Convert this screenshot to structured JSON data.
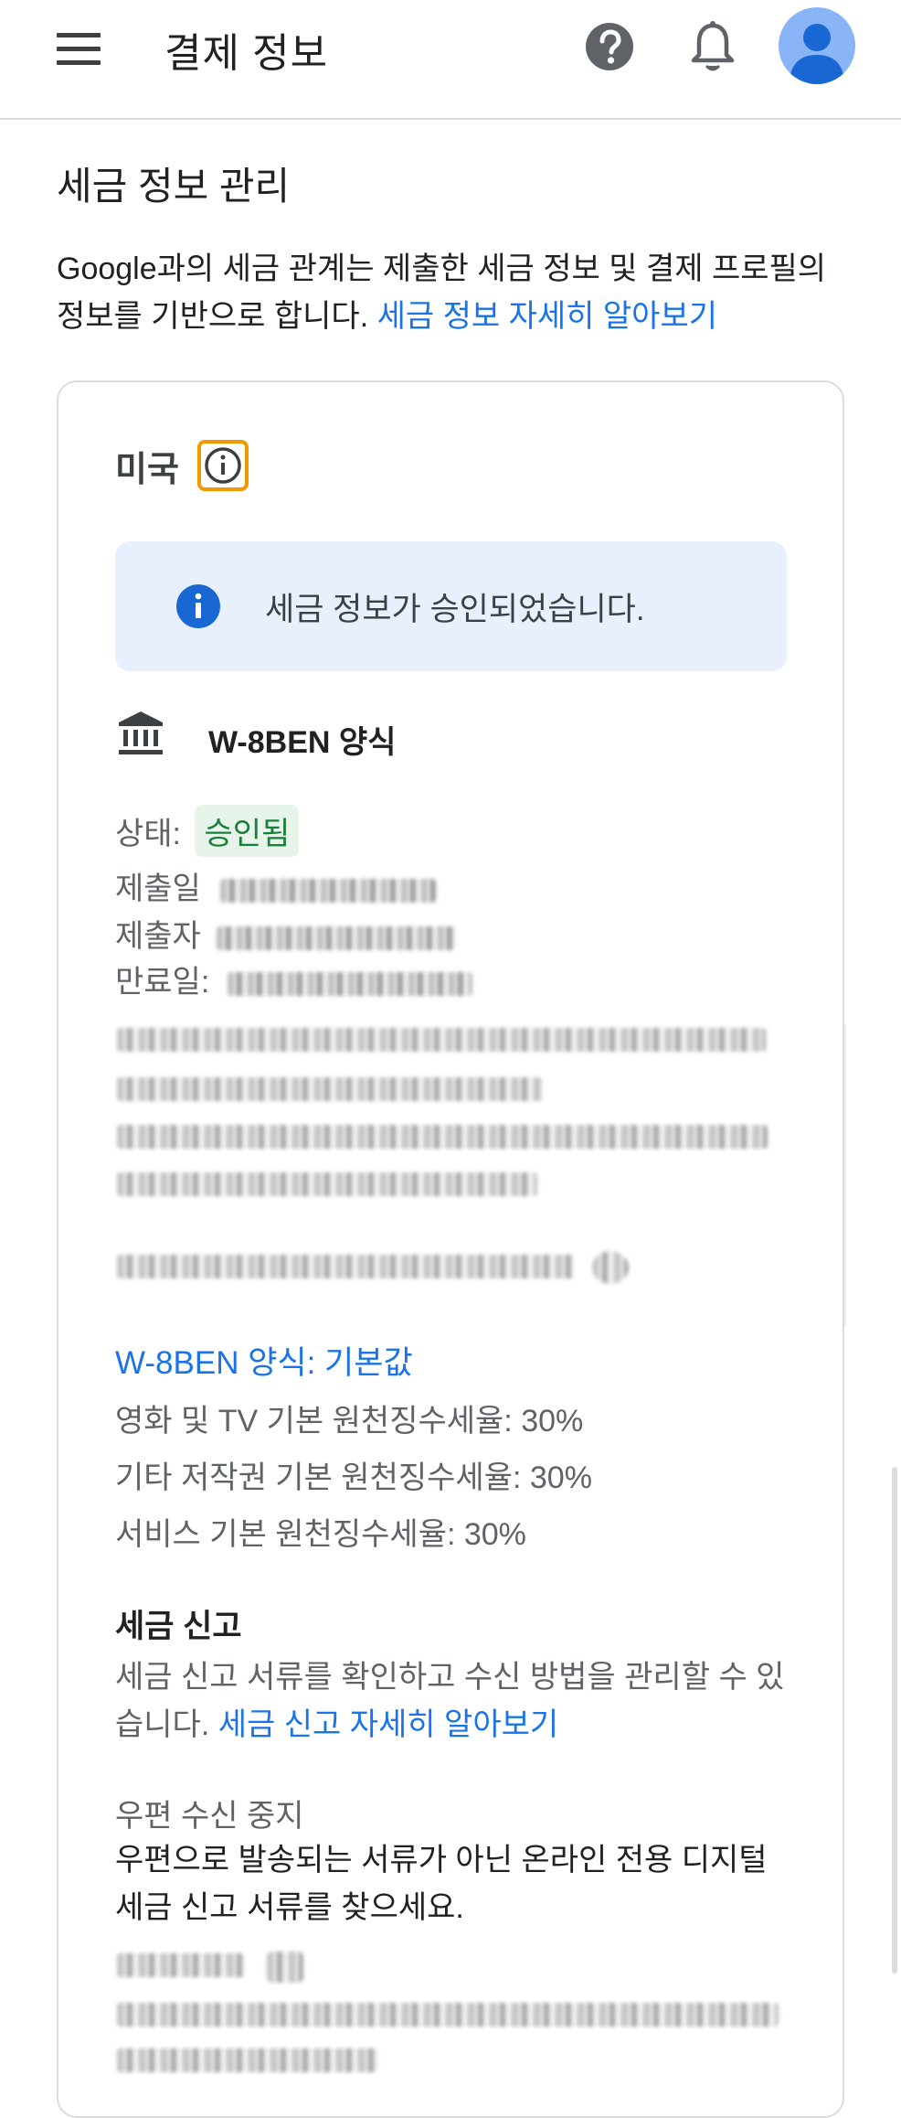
{
  "header": {
    "title": "결제 정보",
    "icons": [
      "menu-icon",
      "help-icon",
      "notifications-icon",
      "account-avatar"
    ]
  },
  "tax_section": {
    "title": "세금 정보 관리",
    "intro_text": "Google과의 세금 관계는 제출한 세금 정보 및 결제 프로필의 정보를 기반으로 합니다. ",
    "intro_link": "세금 정보 자세히 알아보기"
  },
  "card": {
    "country": "미국",
    "banner_text": "세금 정보가 승인되었습니다.",
    "form_title": "W-8BEN 양식",
    "status_label": "상태:",
    "status_value": "승인됨",
    "submitted_label": "제출일",
    "submitter_label": "제출자",
    "expiry_label": "만료일:",
    "defaults_link": "W-8BEN 양식: 기본값",
    "rates": [
      "영화 및 TV 기본 원천징수세율: 30%",
      "기타 저작권 기본 원천징수세율: 30%",
      "서비스 기본 원천징수세율: 30%"
    ],
    "tax_filing_title": "세금 신고",
    "tax_filing_text": "세금 신고 서류를 확인하고 수신 방법을 관리할 수 있습니다. ",
    "tax_filing_link": "세금 신고 자세히 알아보기",
    "mail_stop_label": "우편 수신 중지",
    "mail_stop_text": "우편으로 발송되는 서류가 아닌 온라인 전용 디지털 세금 신고 서류를 찾으세요."
  },
  "colors": {
    "accent": "#1a73e8",
    "banner_bg": "#e8f0fe",
    "approved_bg": "#e6f4ea",
    "approved_text": "#188038",
    "highlight_outline": "#f29900"
  }
}
